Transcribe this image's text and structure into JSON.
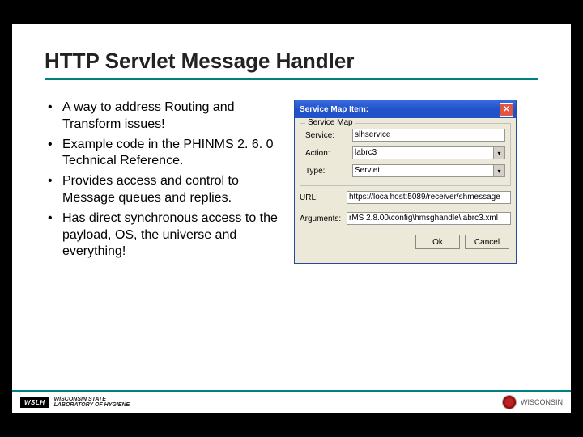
{
  "title": "HTTP Servlet Message Handler",
  "bullets": [
    "A way to address Routing and Transform issues!",
    "Example code in the PHINMS 2. 6. 0 Technical Reference.",
    "Provides access and control to Message queues and replies.",
    "Has direct synchronous access to the payload, OS, the universe and everything!"
  ],
  "dialog": {
    "title": "Service Map Item:",
    "group_label": "Service Map",
    "labels": {
      "service": "Service:",
      "action": "Action:",
      "type": "Type:",
      "url": "URL:",
      "arguments": "Arguments:"
    },
    "values": {
      "service": "slhservice",
      "action": "labrc3",
      "type": "Servlet",
      "url": "https://localhost:5089/receiver/shmessage",
      "arguments": "rMS 2.8.00\\config\\hmsghandle\\labrc3.xml"
    },
    "buttons": {
      "ok": "Ok",
      "cancel": "Cancel"
    }
  },
  "footer": {
    "wslh_logo": "WSLH",
    "wslh_line1": "WISCONSIN STATE",
    "wslh_line2": "LABORATORY OF HYGIENE",
    "uw_line1": "WISCONSIN"
  }
}
